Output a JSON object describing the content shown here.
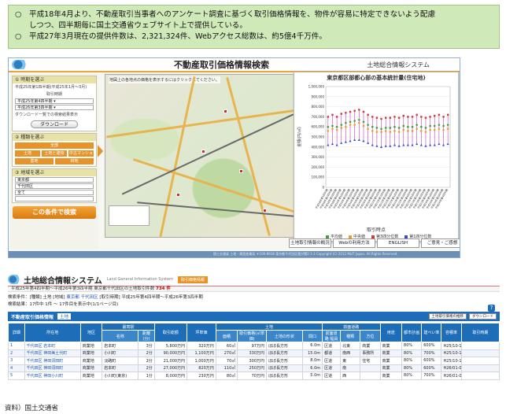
{
  "notice": {
    "bullet": "○",
    "line1": "平成18年4月より、不動産取引当事者へのアンケート調査に基づく取引価格情報を、物件が容易に特定できないよう配慮",
    "line1_cont": "しつつ、四半期毎に国土交通省ウェブサイト上で提供している。",
    "line2": "平成27年3月現在の提供件数は、2,321,324件、Webアクセス総数は、約5億4千万件。"
  },
  "shot1": {
    "title": "不動産取引価格情報検索",
    "system_name": "土地総合情報システム",
    "sidebar": {
      "period_head": "① 時期を選ぶ",
      "period_line1": "平成25年第1四半期(平成25年1月～3月)",
      "period_label": "取引時期",
      "period_from": "平成25年第4四半期 ▾",
      "period_to": "平成26年第3四半期 ▾",
      "download_hint": "ダウンロード一覧での検索結果表示",
      "download_btn": "ダウンロード",
      "type_head": "② 種類を選ぶ",
      "type_all": "全部",
      "type_land": "土地",
      "type_bldg": "土地と建物",
      "type_condo": "中古マンション",
      "type_farm": "農地",
      "type_forest": "林地",
      "area_head": "③ 地域を選ぶ",
      "pref": "東京都",
      "city": "千代田区",
      "district": "全て",
      "station": "",
      "search_btn": "この条件で検索"
    },
    "map": {
      "hint": "地図上の各地点の価格を表示するにはクリックしてください。"
    },
    "links": [
      "土地取引情報の概況",
      "Webの利用方法",
      "ENGLISH",
      "ご意見・ご感想"
    ],
    "footer": "国土交通省 土地・建設産業局 〒100-8918 東京都千代田区霞が関2-1-3 Copyright (C) 2012 MLIT Japan. All Rights Reserved."
  },
  "chart_data": {
    "type": "range",
    "title": "東京都区部都心部の基本統計量(住宅地)",
    "xlabel": "取引時点",
    "ylabel": "金額(円/㎡)",
    "ylim": [
      0,
      1000000
    ],
    "yticks": [
      "0",
      "100,000",
      "200,000",
      "300,000",
      "400,000",
      "500,000",
      "600,000",
      "700,000",
      "800,000",
      "900,000",
      "1,000,000"
    ],
    "categories": [
      "平成18年第1四半期",
      "平成18年第2四半期",
      "平成18年第3四半期",
      "平成18年第4四半期",
      "平成19年第1四半期",
      "平成19年第2四半期",
      "平成19年第3四半期",
      "平成19年第4四半期",
      "平成20年第1四半期",
      "平成20年第2四半期",
      "平成20年第3四半期",
      "平成20年第4四半期",
      "平成21年第1四半期",
      "平成21年第2四半期",
      "平成21年第3四半期",
      "平成21年第4四半期",
      "平成22年第1四半期",
      "平成22年第2四半期",
      "平成22年第3四半期",
      "平成22年第4四半期",
      "平成23年第1四半期",
      "平成23年第2四半期",
      "平成23年第3四半期",
      "平成23年第4四半期",
      "平成24年第1四半期",
      "平成24年第2四半期",
      "平成24年第3四半期",
      "平成24年第4四半期"
    ],
    "series": [
      {
        "name": "第3四分位数",
        "color": "#d23a3a",
        "values": [
          700000,
          720000,
          700000,
          730000,
          740000,
          750000,
          760000,
          770000,
          750000,
          720000,
          700000,
          690000,
          680000,
          690000,
          690000,
          700000,
          690000,
          710000,
          700000,
          700000,
          720000,
          700000,
          690000,
          700000,
          710000,
          720000,
          700000,
          720000
        ]
      },
      {
        "name": "中央値",
        "color": "#e7a020",
        "values": [
          560000,
          580000,
          570000,
          590000,
          600000,
          620000,
          620000,
          640000,
          610000,
          580000,
          560000,
          550000,
          550000,
          560000,
          550000,
          560000,
          550000,
          570000,
          560000,
          560000,
          580000,
          560000,
          550000,
          570000,
          570000,
          580000,
          570000,
          580000
        ]
      },
      {
        "name": "平均値",
        "color": "#3f9f3f",
        "values": [
          600000,
          610000,
          600000,
          620000,
          640000,
          650000,
          660000,
          670000,
          650000,
          620000,
          600000,
          590000,
          580000,
          590000,
          590000,
          600000,
          590000,
          610000,
          600000,
          600000,
          620000,
          600000,
          590000,
          610000,
          610000,
          620000,
          610000,
          620000
        ]
      },
      {
        "name": "第1四分位数",
        "color": "#3a4bc8",
        "values": [
          420000,
          430000,
          420000,
          440000,
          450000,
          460000,
          470000,
          470000,
          460000,
          440000,
          420000,
          410000,
          400000,
          410000,
          410000,
          420000,
          410000,
          420000,
          420000,
          420000,
          430000,
          420000,
          410000,
          420000,
          420000,
          430000,
          420000,
          430000
        ]
      }
    ],
    "legend": "bottom"
  },
  "shot2": {
    "title": "土地総合情報システム",
    "subtitle": "Land General Information System",
    "badge": "取引価格情報",
    "bar_prefix": "平成25年第4四半期～平成26年第3四半期 東京都千代田区の土地取引件数",
    "bar_count": "734 件",
    "criteria_prefix": "検索条件：[種類] 土地 [地域] ",
    "criteria_area": "東京都 千代田区",
    "criteria_suffix": " [取引時期] 平成25年第4四半期～平成26年第3四半期",
    "count_line": "検索結果：17件中 1件 ～ 17件目を表示中(1/1ページ目)",
    "help": "?",
    "tab_main": "不動産取引価格情報",
    "tab_sub": "土地",
    "btn1": "土地取引価格の推移",
    "btn2": "ダウンロード",
    "columns": [
      "詳細",
      "所在地",
      "地区",
      "最寄駅 名称",
      "距離",
      "取引総額",
      "坪単価",
      "面積",
      "取引価格(㎡単価)",
      "土地の形状",
      "間口",
      "前面道路 幅員",
      "種類",
      "方位",
      "用途",
      "都市計画",
      "建ぺい率",
      "容積率",
      "取引時期"
    ],
    "head_groups": {
      "station": "最寄駅",
      "land": "土地",
      "road": "前面道路",
      "name": "名称",
      "distance": "距離(分)"
    },
    "rows": [
      [
        "1",
        "千代田区 岩本町",
        "商業地",
        "岩本町",
        "3分",
        "5,800万円",
        "320万円",
        "60㎡",
        "97万円",
        "ほぼ長方形",
        "6.0m",
        "区道",
        "北東",
        "商業",
        "商業",
        "80%",
        "600%",
        "H25/10-12月"
      ],
      [
        "2",
        "千代田区 神田美土代町",
        "商業地",
        "小川町",
        "2分",
        "90,000万円",
        "1,100万円",
        "270㎡",
        "330万円",
        "ほぼ長方形",
        "15.0m",
        "都道",
        "南西",
        "事務所",
        "商業",
        "80%",
        "700%",
        "H25/10-12月"
      ],
      [
        "3",
        "千代田区 神田須田町",
        "商業地",
        "淡路町",
        "2分",
        "21,000万円",
        "1,000万円",
        "70㎡",
        "300万円",
        "ほぼ長方形",
        "8.0m",
        "区道",
        "東",
        "住宅",
        "商業",
        "80%",
        "600%",
        "H25/10-12月"
      ],
      [
        "4",
        "千代田区 神田須田町",
        "商業地",
        "岩本町",
        "2分",
        "27,000万円",
        "820万円",
        "110㎡",
        "250万円",
        "ほぼ長方形",
        "6.0m",
        "区道",
        "南",
        "",
        "商業",
        "80%",
        "600%",
        "H26/01-03月"
      ],
      [
        "5",
        "千代田区 神田小川町",
        "商業地",
        "小川町(東京)",
        "1分",
        "8,000万円",
        "230万円",
        "80㎡",
        "70万円",
        "ほぼ長方形",
        "5.0m",
        "区道",
        "西",
        "",
        "商業",
        "80%",
        "700%",
        "H26/01-03月"
      ]
    ]
  },
  "source": "資料）国土交通省"
}
